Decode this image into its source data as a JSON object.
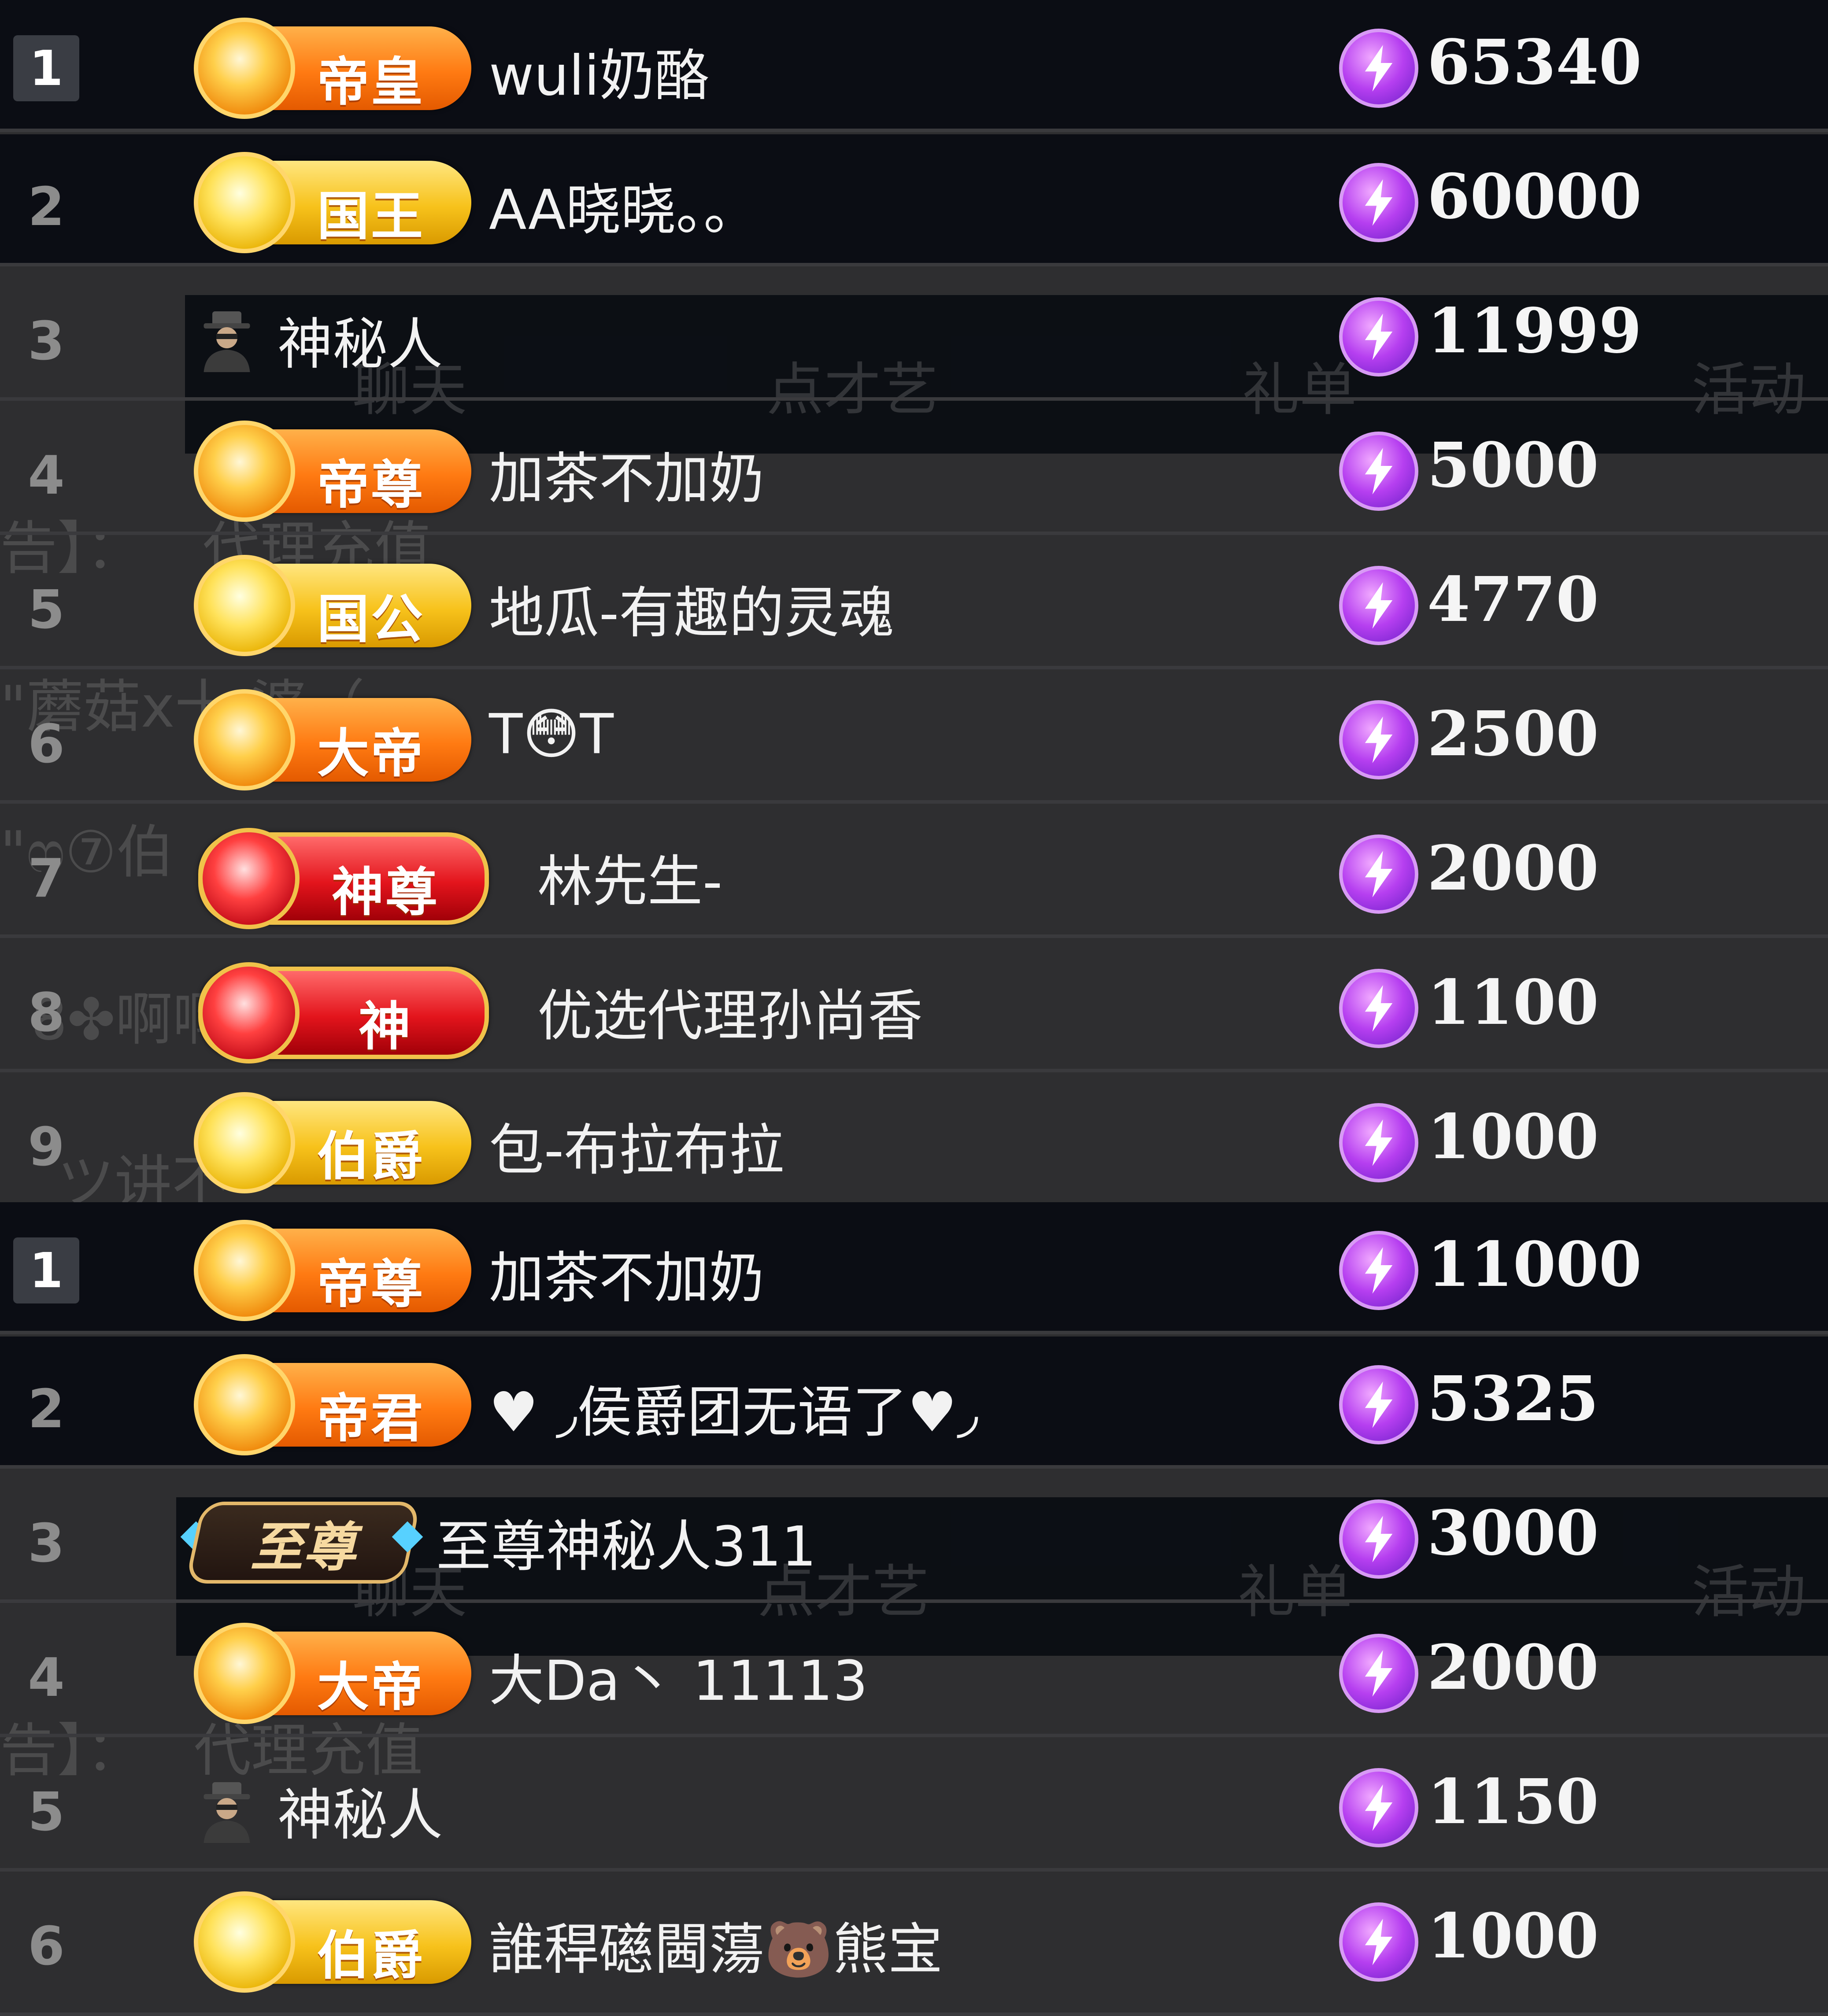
{
  "ghost_text": {
    "tab_chat": "聊天",
    "tab_request": "点才艺",
    "tab_gift": "礼单",
    "tab_activity": "活动",
    "notice_suffix": "告】：",
    "agent_recharge": "代理充值",
    "chat_1": "\"蘑菇x十 婆（",
    "chat_2": "\"ෆ⑦伯",
    "chat_3": "8✤啊啊",
    "chat_4": "ツ讲不"
  },
  "boards": [
    {
      "name": "board-1",
      "rows": [
        {
          "rank": "1",
          "badge_type": "orange",
          "badge_label": "帝皇",
          "name": "wuli奶酪",
          "score": "65340"
        },
        {
          "rank": "2",
          "badge_type": "gold",
          "badge_label": "国王",
          "name": "AA晓晓。。",
          "score": "60000"
        },
        {
          "rank": "3",
          "badge_type": "mystery",
          "badge_label": "",
          "name": "神秘人",
          "score": "11999"
        },
        {
          "rank": "4",
          "badge_type": "orange",
          "badge_label": "帝尊",
          "name": "加茶不加奶",
          "score": "5000"
        },
        {
          "rank": "5",
          "badge_type": "gold",
          "badge_label": "国公",
          "name": "地瓜-有趣的灵魂",
          "score": "4770"
        },
        {
          "rank": "6",
          "badge_type": "orange",
          "badge_label": "大帝",
          "name": "T😳T",
          "score": "2500"
        },
        {
          "rank": "7",
          "badge_type": "red",
          "badge_label": "神尊",
          "name": "林先生-",
          "score": "2000"
        },
        {
          "rank": "8",
          "badge_type": "red",
          "badge_label": "神",
          "name": "优选代理孙尚香",
          "score": "1100"
        },
        {
          "rank": "9",
          "badge_type": "gold",
          "badge_label": "伯爵",
          "name": "包-布拉布拉",
          "score": "1000"
        }
      ]
    },
    {
      "name": "board-2",
      "rows": [
        {
          "rank": "1",
          "badge_type": "orange",
          "badge_label": "帝尊",
          "name": "加茶不加奶",
          "score": "11000"
        },
        {
          "rank": "2",
          "badge_type": "orange",
          "badge_label": "帝君",
          "name": "♥ ◞侯爵团无语了♥◞",
          "score": "5325"
        },
        {
          "rank": "3",
          "badge_type": "zhizun",
          "badge_label": "至尊",
          "name": "至尊神秘人311",
          "score": "3000"
        },
        {
          "rank": "4",
          "badge_type": "orange",
          "badge_label": "大帝",
          "name": "大Da丶 11113",
          "score": "2000"
        },
        {
          "rank": "5",
          "badge_type": "mystery",
          "badge_label": "",
          "name": "神秘人",
          "score": "1150"
        },
        {
          "rank": "6",
          "badge_type": "gold",
          "badge_label": "伯爵",
          "name": "誰稈礠閪蕩🐻熊宝",
          "score": "1000"
        }
      ]
    }
  ],
  "colors": {
    "dark_row": "#0b0d14",
    "badge_orange": "#ff7a12",
    "badge_gold": "#f7c21b",
    "badge_red": "#e3141c",
    "coin_purple": "#b63ff0"
  }
}
